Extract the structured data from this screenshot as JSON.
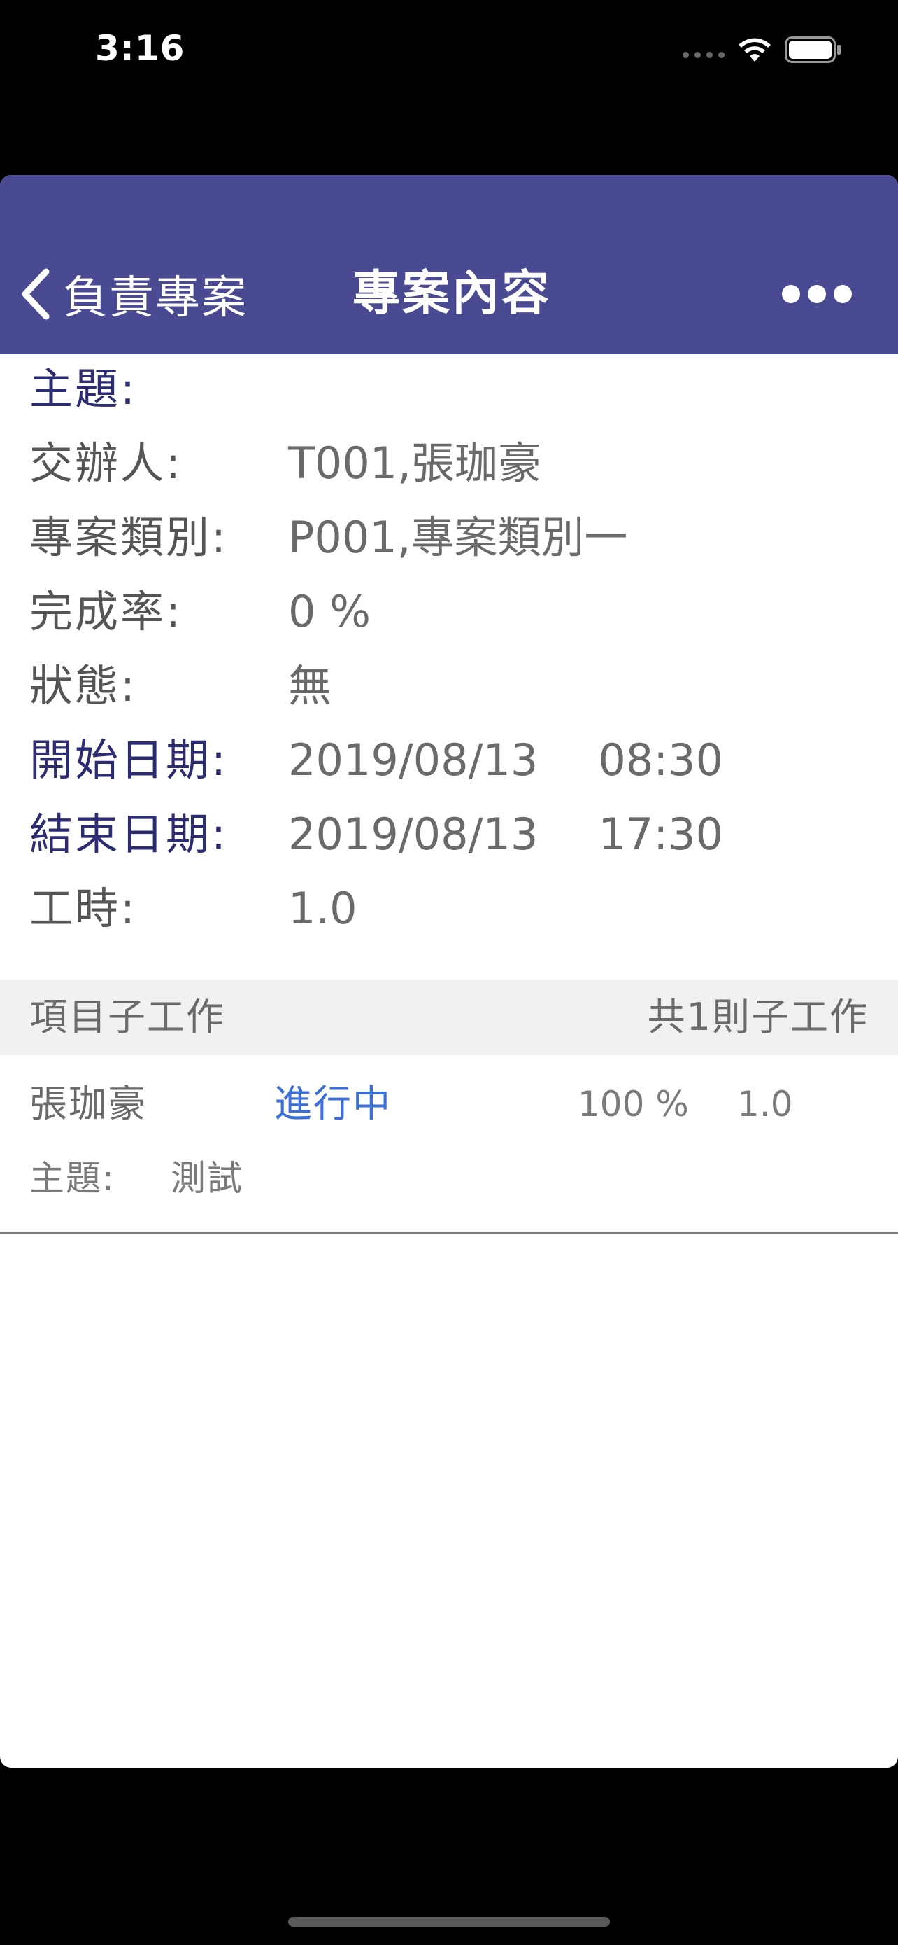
{
  "status_bar": {
    "time": "3:16"
  },
  "navbar": {
    "back_label": "負責專案",
    "title": "專案內容"
  },
  "details": {
    "subject_label": "主題:",
    "subject_value": "",
    "assigner_label": "交辦人:",
    "assigner_value": "T001,張珈豪",
    "category_label": "專案類別:",
    "category_value": "P001,專案類別一",
    "completion_label": "完成率:",
    "completion_value": "0 %",
    "state_label": "狀態:",
    "state_value": "無",
    "start_label": "開始日期:",
    "start_date": "2019/08/13",
    "start_time": "08:30",
    "end_label": "結束日期:",
    "end_date": "2019/08/13",
    "end_time": "17:30",
    "hours_label": "工時:",
    "hours_value": "1.0"
  },
  "subtasks_section": {
    "title": "項目子工作",
    "count_text": "共1則子工作"
  },
  "subtasks": [
    {
      "assignee": "張珈豪",
      "status": "進行中",
      "completion": "100 %",
      "hours": "1.0",
      "subject_label": "主題:",
      "subject_value": "測試"
    }
  ],
  "colors": {
    "navbar": "#4a4a92",
    "status_link": "#3a6fd8",
    "emphasis_label": "#2c2c72"
  }
}
